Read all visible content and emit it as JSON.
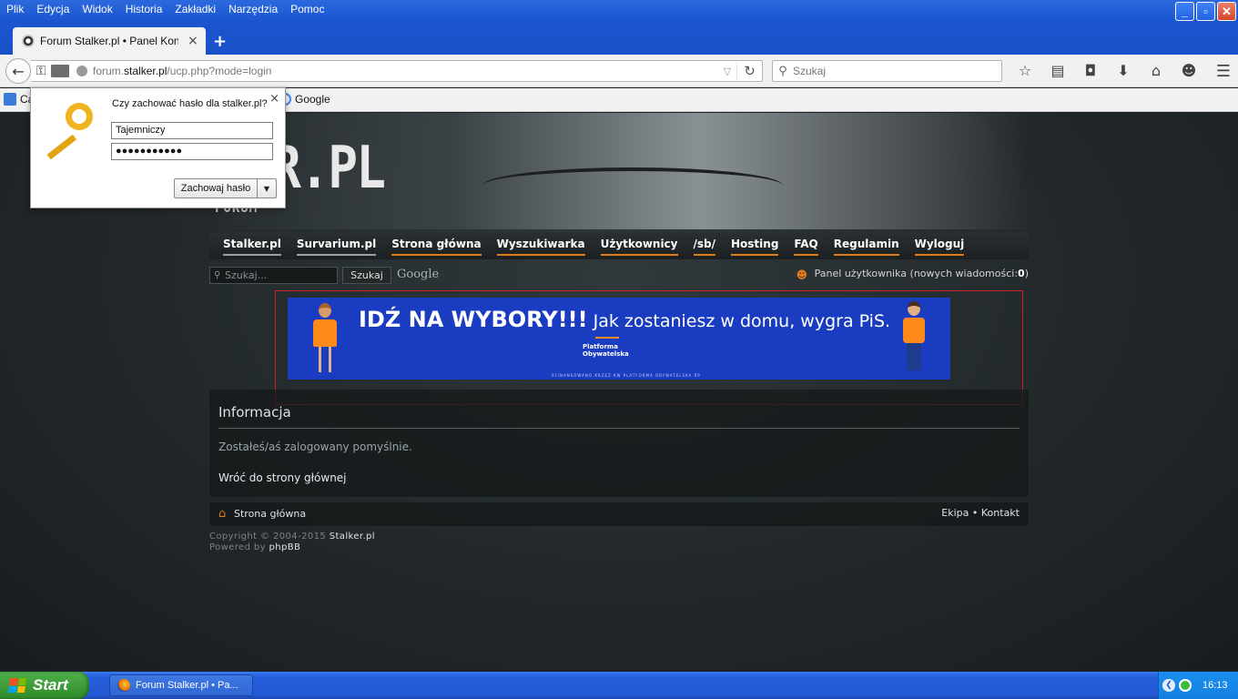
{
  "window": {
    "menu": [
      "Plik",
      "Edycja",
      "Widok",
      "Historia",
      "Zakładki",
      "Narzędzia",
      "Pomoc"
    ],
    "controls": {
      "minimize": "_",
      "maximize": "▫",
      "close": "✕"
    }
  },
  "tab": {
    "title": "Forum Stalker.pl • Panel Kont…",
    "close": "×",
    "new_tab": "+"
  },
  "nav": {
    "url_prefix": "forum.",
    "url_domain": "stalker.pl",
    "url_path": "/ucp.php?mode=login",
    "search_placeholder": "Szukaj"
  },
  "bookmarks": {
    "first": "Ca",
    "google": "Google"
  },
  "popup": {
    "question": "Czy zachować hasło dla stalker.pl?",
    "username": "Tajemniczy",
    "password": "●●●●●●●●●●●",
    "save_label": "Zachowaj hasło",
    "close": "×",
    "menu_arrow": "▼"
  },
  "site": {
    "logo": "KER.PL",
    "logo_sub": "FORUM",
    "menu": [
      "Stalker.pl",
      "Survarium.pl",
      "Strona główna",
      "Wyszukiwarka",
      "Użytkownicy",
      "/sb/",
      "Hosting",
      "FAQ",
      "Regulamin",
      "Wyloguj"
    ],
    "search_placeholder": "Szukaj...",
    "search_button": "Szukaj",
    "google_label": "Google",
    "user_panel_text": "Panel użytkownika (nowych wiadomości: ",
    "user_panel_count": "0",
    "user_panel_close": ")"
  },
  "ad": {
    "headline_bold": "IDŹ NA WYBORY!!!",
    "headline_rest": " Jak zostaniesz w domu, wygra PiS.",
    "logo_line1": "Platforma",
    "logo_line2": "Obywatelska",
    "footnote": "SFINANSOWANO KRZEŻ KW PLATFORMA OBYWATELSKA RP"
  },
  "info": {
    "title": "Informacja",
    "message": "Zostałeś/aś zalogowany pomyślnie.",
    "link": "Wróć do strony głównej"
  },
  "footer": {
    "home": "Strona główna",
    "team": "Ekipa",
    "sep": " • ",
    "contact": "Kontakt",
    "copyright_prefix": "Copyright © 2004-2015 ",
    "copyright_site": "Stalker.pl",
    "powered_prefix": "Powered by ",
    "powered_link": "phpBB"
  },
  "taskbar": {
    "start": "Start",
    "task_label": "Forum Stalker.pl • Pa...",
    "clock": "16:13"
  },
  "colors": {
    "accent": "#e07b1c",
    "ad_background": "#1a3cc0",
    "ad_frame": "#d0202a"
  }
}
